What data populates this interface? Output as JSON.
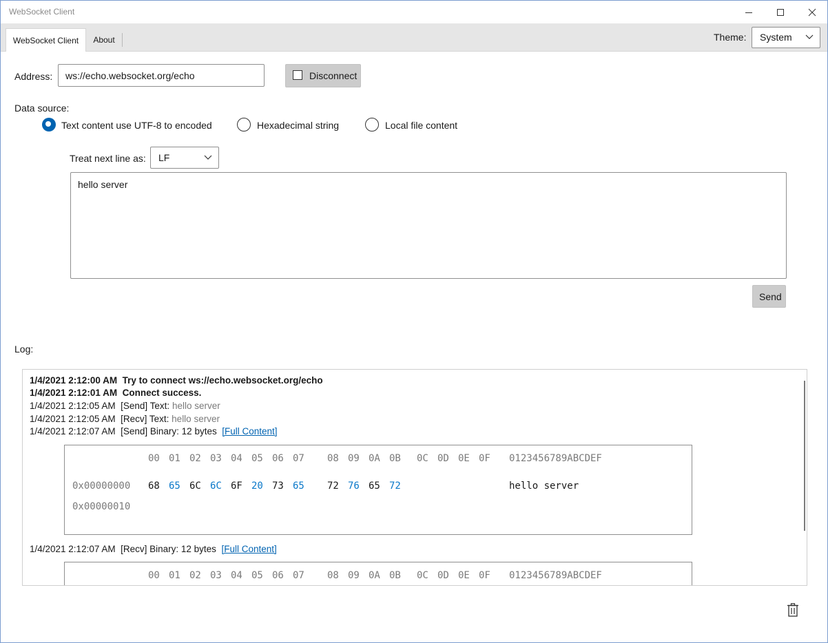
{
  "window": {
    "title": "WebSocket Client"
  },
  "tabs": [
    {
      "label": "WebSocket Client",
      "active": true
    },
    {
      "label": "About",
      "active": false
    }
  ],
  "theme": {
    "label": "Theme:",
    "value": "System"
  },
  "address": {
    "label": "Address:",
    "value": "ws://echo.websocket.org/echo"
  },
  "connect_button": {
    "label": "Disconnect",
    "checked": false
  },
  "data_source": {
    "label": "Data source:",
    "options": [
      {
        "label": "Text content use UTF-8 to encoded",
        "selected": true
      },
      {
        "label": "Hexadecimal string",
        "selected": false
      },
      {
        "label": "Local file content",
        "selected": false
      }
    ]
  },
  "next_line": {
    "label": "Treat next line as:",
    "value": "LF"
  },
  "message": {
    "text": "hello server"
  },
  "send_button": {
    "label": "Send"
  },
  "log": {
    "label": "Log:",
    "entries": [
      {
        "time": "1/4/2021 2:12:00 AM",
        "text": "Try to connect ws://echo.websocket.org/echo"
      },
      {
        "time": "1/4/2021 2:12:01 AM",
        "text": "Connect success."
      },
      {
        "time": "1/4/2021 2:12:05 AM",
        "prefix": "[Send] Text:",
        "value": "hello server"
      },
      {
        "time": "1/4/2021 2:12:05 AM",
        "prefix": "[Recv] Text:",
        "value": "hello server"
      },
      {
        "time": "1/4/2021 2:12:07 AM",
        "prefix": "[Send] Binary: 12 bytes",
        "link": "[Full Content]"
      },
      {
        "time": "1/4/2021 2:12:07 AM",
        "prefix": "[Recv] Binary: 12 bytes",
        "link": "[Full Content]"
      }
    ],
    "hex_header": {
      "columns": [
        "00",
        "01",
        "02",
        "03",
        "04",
        "05",
        "06",
        "07",
        "08",
        "09",
        "0A",
        "0B",
        "0C",
        "0D",
        "0E",
        "0F"
      ],
      "ascii": "0123456789ABCDEF"
    },
    "hex_rows": [
      {
        "offset": "0x00000000",
        "bytes": [
          "68",
          "65",
          "6C",
          "6C",
          "6F",
          "20",
          "73",
          "65",
          "72",
          "76",
          "65",
          "72"
        ],
        "ascii": "hello server"
      },
      {
        "offset": "0x00000010",
        "bytes": [],
        "ascii": ""
      }
    ]
  },
  "icons": {
    "trash": "trash-icon",
    "minimize": "minimize-icon",
    "maximize": "maximize-icon",
    "close": "close-icon"
  },
  "colors": {
    "accent": "#0063b1",
    "hex_highlight": "#0a78c9",
    "button_gray": "#cccccc"
  }
}
